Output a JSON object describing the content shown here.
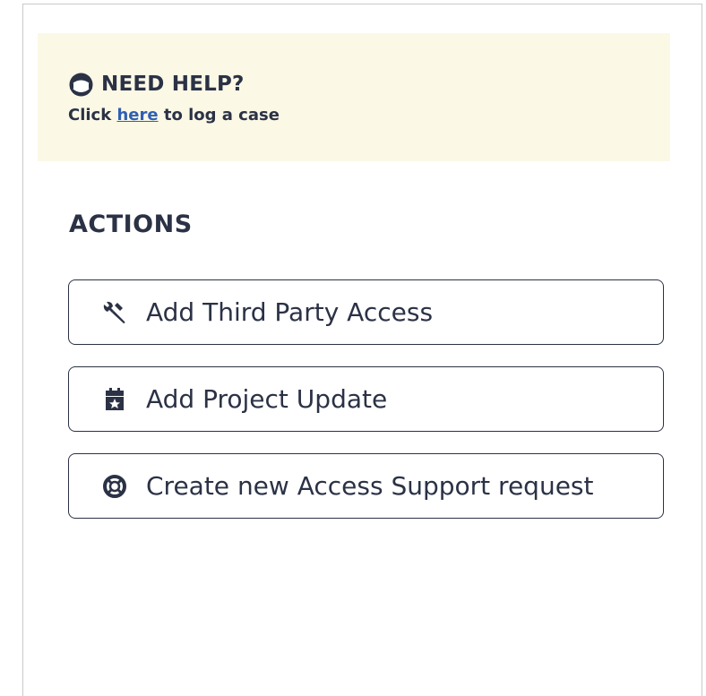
{
  "help": {
    "title": "NEED HELP?",
    "sub_prefix": "Click ",
    "link_label": "here",
    "sub_suffix": " to log a case",
    "icon": "support-agent-icon",
    "background": "#fbf8e6",
    "link_color": "#2f5fb3"
  },
  "actions": {
    "title": "ACTIONS",
    "buttons": [
      {
        "label": "Add Third Party Access",
        "icon": "tools-icon"
      },
      {
        "label": "Add Project Update",
        "icon": "calendar-star-icon"
      },
      {
        "label": "Create new Access Support request",
        "icon": "lifebuoy-icon"
      }
    ]
  },
  "colors": {
    "text": "#2b3245",
    "border": "#2b3245"
  }
}
